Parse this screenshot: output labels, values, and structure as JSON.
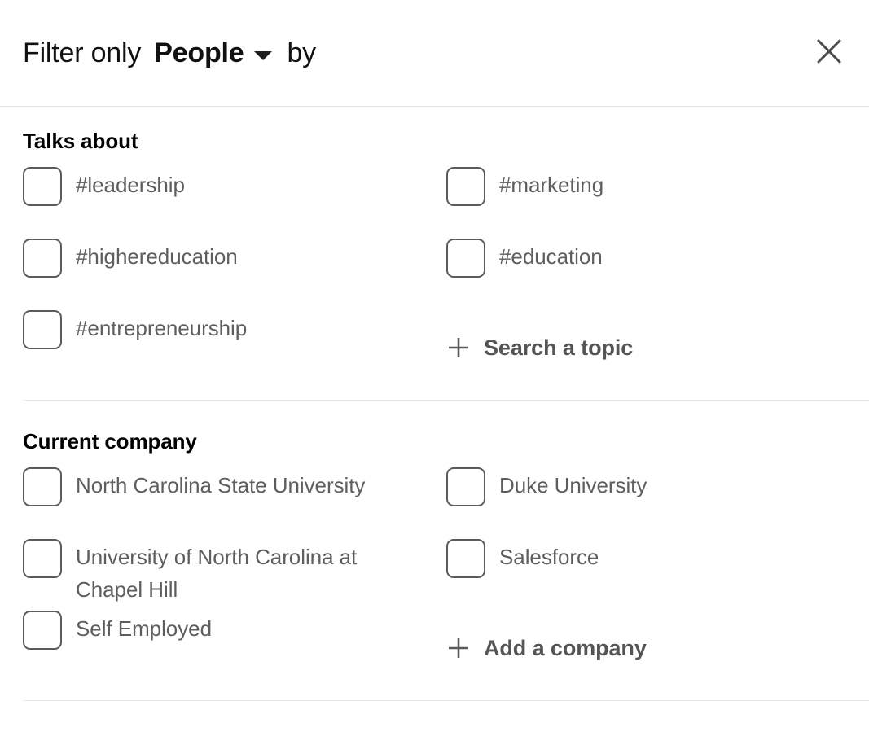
{
  "header": {
    "prefix": "Filter only",
    "entity": "People",
    "suffix": "by",
    "caret_icon": "chevron-down-icon",
    "close_icon": "close-icon"
  },
  "sections": [
    {
      "title": "Talks about",
      "left_options": [
        {
          "label": "#leadership",
          "checked": false
        },
        {
          "label": "#highereducation",
          "checked": false
        },
        {
          "label": "#entrepreneurship",
          "checked": false
        }
      ],
      "right_options": [
        {
          "label": "#marketing",
          "checked": false
        },
        {
          "label": "#education",
          "checked": false
        }
      ],
      "action": {
        "icon": "plus-icon",
        "label": "Search a topic"
      }
    },
    {
      "title": "Current company",
      "left_options": [
        {
          "label": "North Carolina State University",
          "checked": false
        },
        {
          "label": "University of North Carolina at Chapel Hill",
          "checked": false
        },
        {
          "label": "Self Employed",
          "checked": false
        }
      ],
      "right_options": [
        {
          "label": "Duke University",
          "checked": false
        },
        {
          "label": "Salesforce",
          "checked": false
        }
      ],
      "action": {
        "icon": "plus-icon",
        "label": "Add a company"
      }
    }
  ],
  "colors": {
    "text_primary": "#000000",
    "text_secondary": "#5e5e5e",
    "text_action": "#555555",
    "border": "#e9e9e9",
    "checkbox_border": "#5b5b5b",
    "background": "#ffffff"
  }
}
